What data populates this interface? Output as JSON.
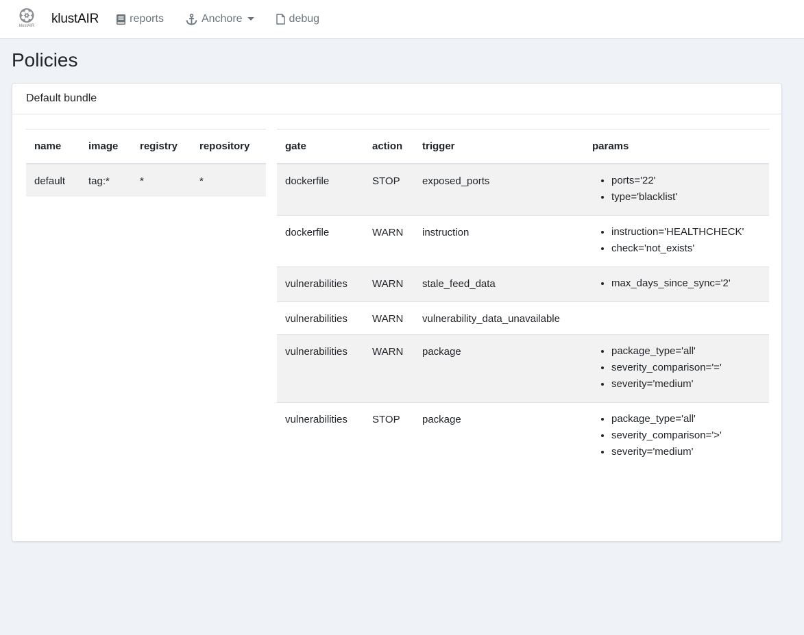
{
  "navbar": {
    "logo_caption": "klustAIR",
    "brand_part1": "klust",
    "brand_part2": "AIR",
    "items": [
      {
        "label": "reports",
        "icon": "book-icon"
      },
      {
        "label": "Anchore",
        "icon": "anchor-icon"
      },
      {
        "label": "debug",
        "icon": "file-icon"
      }
    ]
  },
  "page": {
    "title": "Policies"
  },
  "bundle": {
    "header": "Default bundle",
    "mappings": {
      "columns": [
        "name",
        "image",
        "registry",
        "repository"
      ],
      "rows": [
        [
          "default",
          "tag:*",
          "*",
          "*"
        ]
      ]
    },
    "rules": {
      "columns": [
        "gate",
        "action",
        "trigger",
        "params"
      ],
      "rows": [
        {
          "gate": "dockerfile",
          "action": "STOP",
          "trigger": "exposed_ports",
          "params": [
            "ports='22'",
            "type='blacklist'"
          ]
        },
        {
          "gate": "dockerfile",
          "action": "WARN",
          "trigger": "instruction",
          "params": [
            "instruction='HEALTHCHECK'",
            "check='not_exists'"
          ]
        },
        {
          "gate": "vulnerabilities",
          "action": "WARN",
          "trigger": "stale_feed_data",
          "params": [
            "max_days_since_sync='2'"
          ]
        },
        {
          "gate": "vulnerabilities",
          "action": "WARN",
          "trigger": "vulnerability_data_unavailable",
          "params": []
        },
        {
          "gate": "vulnerabilities",
          "action": "WARN",
          "trigger": "package",
          "params": [
            "package_type='all'",
            "severity_comparison='='",
            "severity='medium'"
          ]
        },
        {
          "gate": "vulnerabilities",
          "action": "STOP",
          "trigger": "package",
          "params": [
            "package_type='all'",
            "severity_comparison='>'",
            "severity='medium'"
          ]
        }
      ]
    }
  }
}
